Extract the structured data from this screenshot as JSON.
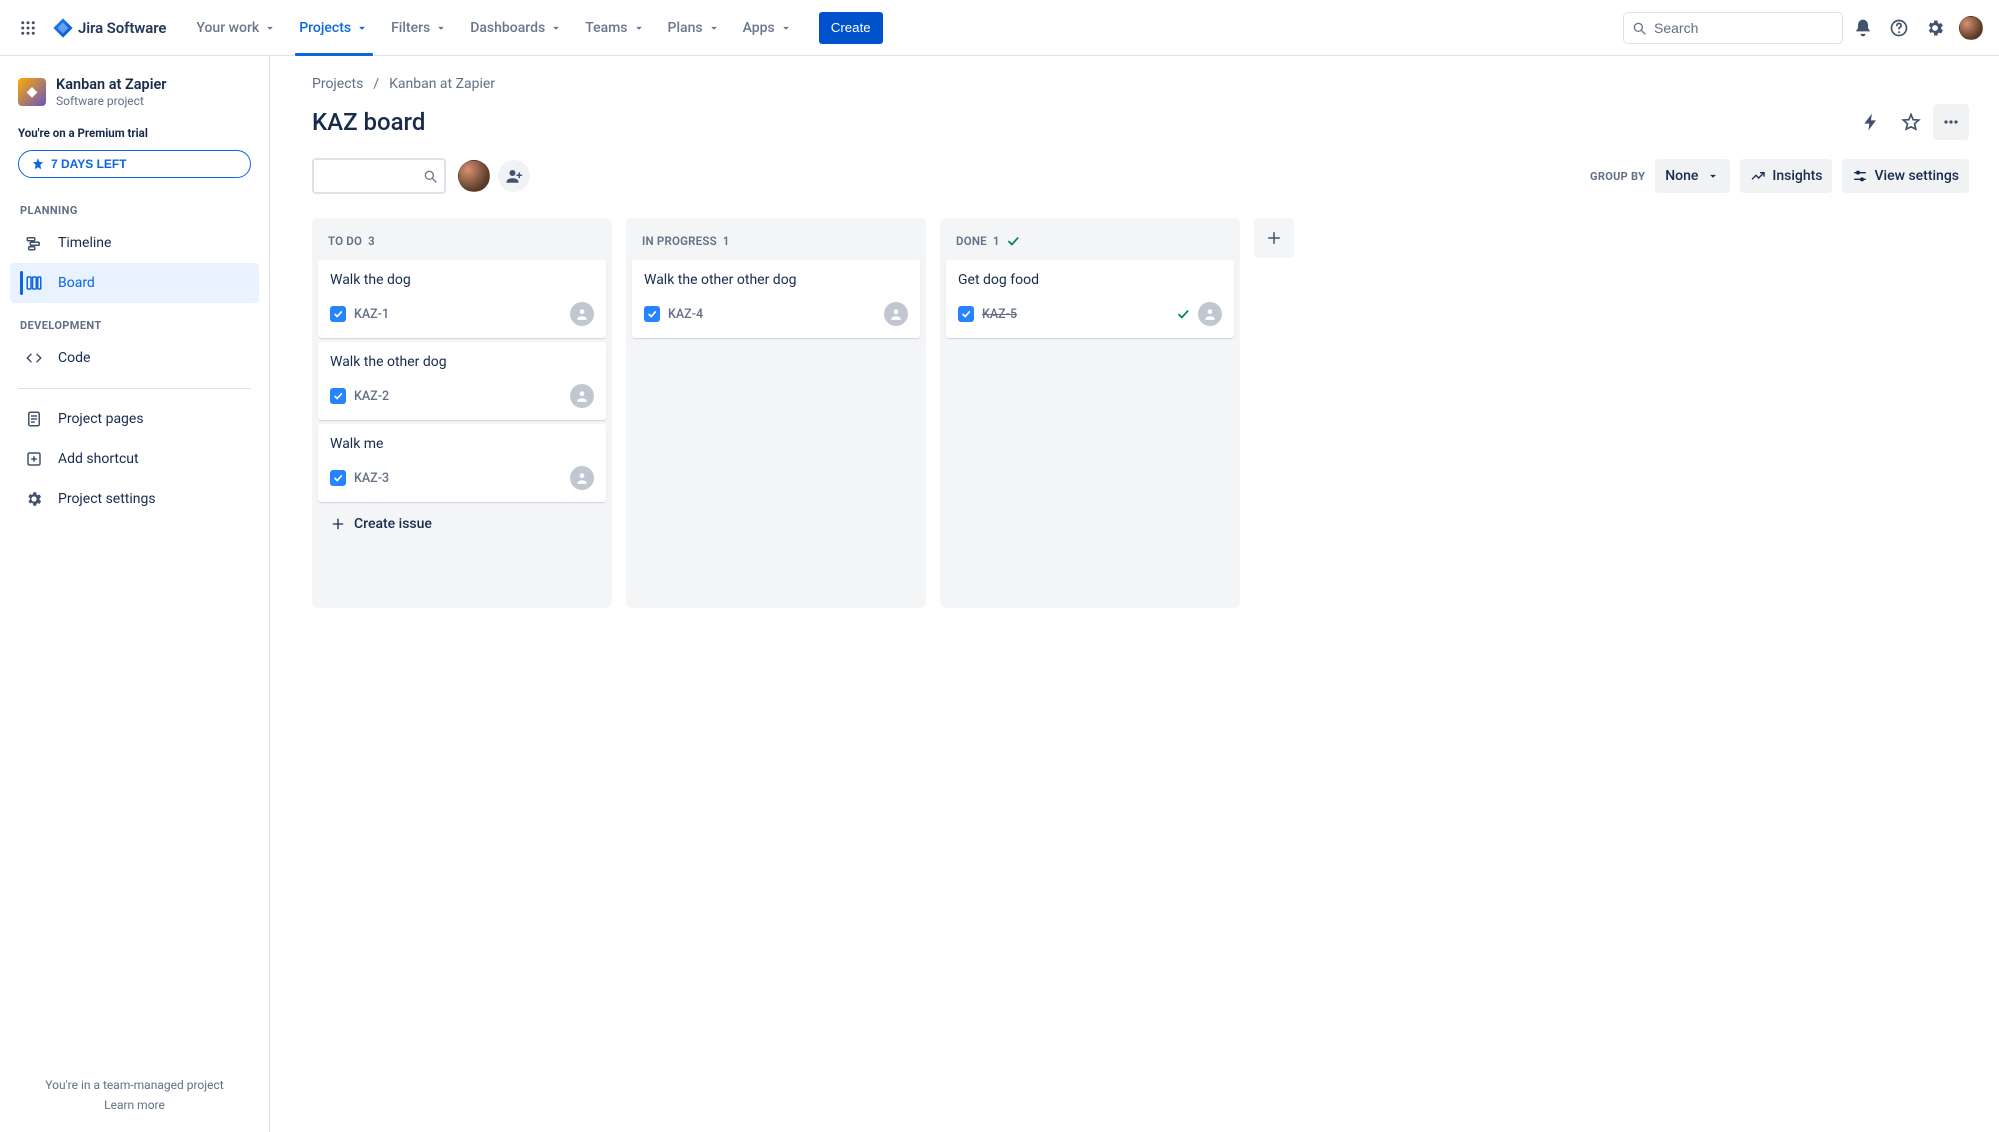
{
  "brand": "Jira Software",
  "nav": {
    "items": [
      {
        "label": "Your work",
        "active": false
      },
      {
        "label": "Projects",
        "active": true
      },
      {
        "label": "Filters",
        "active": false
      },
      {
        "label": "Dashboards",
        "active": false
      },
      {
        "label": "Teams",
        "active": false
      },
      {
        "label": "Plans",
        "active": false
      },
      {
        "label": "Apps",
        "active": false
      }
    ],
    "create": "Create",
    "search_placeholder": "Search"
  },
  "sidebar": {
    "project_name": "Kanban at Zapier",
    "project_subtitle": "Software project",
    "trial_line": "You're on a Premium trial",
    "trial_button": "7 DAYS LEFT",
    "sections": {
      "planning_label": "PLANNING",
      "development_label": "DEVELOPMENT"
    },
    "items": {
      "timeline": "Timeline",
      "board": "Board",
      "code": "Code",
      "project_pages": "Project pages",
      "add_shortcut": "Add shortcut",
      "project_settings": "Project settings"
    },
    "foot_line": "You're in a team-managed project",
    "foot_link": "Learn more"
  },
  "breadcrumbs": {
    "root": "Projects",
    "current": "Kanban at Zapier"
  },
  "page_title": "KAZ board",
  "toolbar": {
    "groupby_label": "GROUP BY",
    "groupby_value": "None",
    "insights": "Insights",
    "view_settings": "View settings"
  },
  "board": {
    "create_issue_label": "Create issue",
    "columns": [
      {
        "title": "TO DO",
        "count": "3",
        "is_done": false,
        "cards": [
          {
            "title": "Walk the dog",
            "key": "KAZ-1",
            "done": false
          },
          {
            "title": "Walk the other dog",
            "key": "KAZ-2",
            "done": false
          },
          {
            "title": "Walk me",
            "key": "KAZ-3",
            "done": false
          }
        ]
      },
      {
        "title": "IN PROGRESS",
        "count": "1",
        "is_done": false,
        "cards": [
          {
            "title": "Walk the other other dog",
            "key": "KAZ-4",
            "done": false
          }
        ]
      },
      {
        "title": "DONE",
        "count": "1",
        "is_done": true,
        "cards": [
          {
            "title": "Get dog food",
            "key": "KAZ-5",
            "done": true
          }
        ]
      }
    ]
  }
}
